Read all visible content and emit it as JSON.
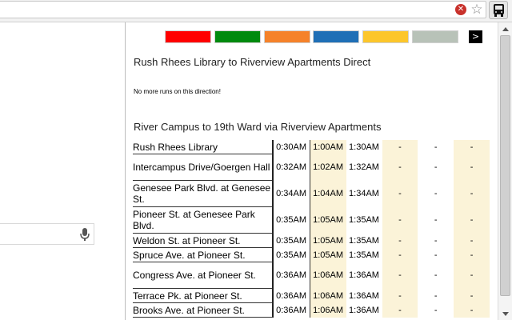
{
  "browser": {
    "stop_glyph": "✕",
    "star_glyph": "☆",
    "extension_icon": "bus-icon"
  },
  "route_colors": [
    "#ff0000",
    "#008a0e",
    "#f5822a",
    "#1f6fb6",
    "#fcc62b",
    "#b8c2b8"
  ],
  "next_button": ">",
  "routes": [
    {
      "title": "Rush Rhees Library to Riverview Apartments Direct",
      "message": "No more runs on this direction!"
    },
    {
      "title": "River Campus to 19th Ward via Riverview Apartments"
    }
  ],
  "schedule": [
    {
      "stop": "Rush Rhees Library",
      "times": [
        "0:30AM",
        "1:00AM",
        "1:30AM",
        "-",
        "-",
        "-"
      ]
    },
    {
      "stop": "Intercampus Drive/Goergen Hall",
      "times": [
        "0:32AM",
        "1:02AM",
        "1:32AM",
        "-",
        "-",
        "-"
      ]
    },
    {
      "stop": "Genesee Park Blvd. at Genesee St.",
      "times": [
        "0:34AM",
        "1:04AM",
        "1:34AM",
        "-",
        "-",
        "-"
      ]
    },
    {
      "stop": "Pioneer St. at Genesee Park Blvd.",
      "times": [
        "0:35AM",
        "1:05AM",
        "1:35AM",
        "-",
        "-",
        "-"
      ]
    },
    {
      "stop": "Weldon St. at Pioneer St.",
      "times": [
        "0:35AM",
        "1:05AM",
        "1:35AM",
        "-",
        "-",
        "-"
      ]
    },
    {
      "stop": "Spruce Ave. at Pioneer St.",
      "times": [
        "0:35AM",
        "1:05AM",
        "1:35AM",
        "-",
        "-",
        "-"
      ]
    },
    {
      "stop": "Congress Ave. at Pioneer St.",
      "times": [
        "0:36AM",
        "1:06AM",
        "1:36AM",
        "-",
        "-",
        "-"
      ]
    },
    {
      "stop": "Terrace Pk. at Pioneer St.",
      "times": [
        "0:36AM",
        "1:06AM",
        "1:36AM",
        "-",
        "-",
        "-"
      ]
    },
    {
      "stop": "Brooks Ave. at Pioneer St.",
      "times": [
        "0:36AM",
        "1:06AM",
        "1:36AM",
        "-",
        "-",
        "-"
      ]
    }
  ],
  "colors": {
    "highlight_column": "#fbf3d8"
  }
}
